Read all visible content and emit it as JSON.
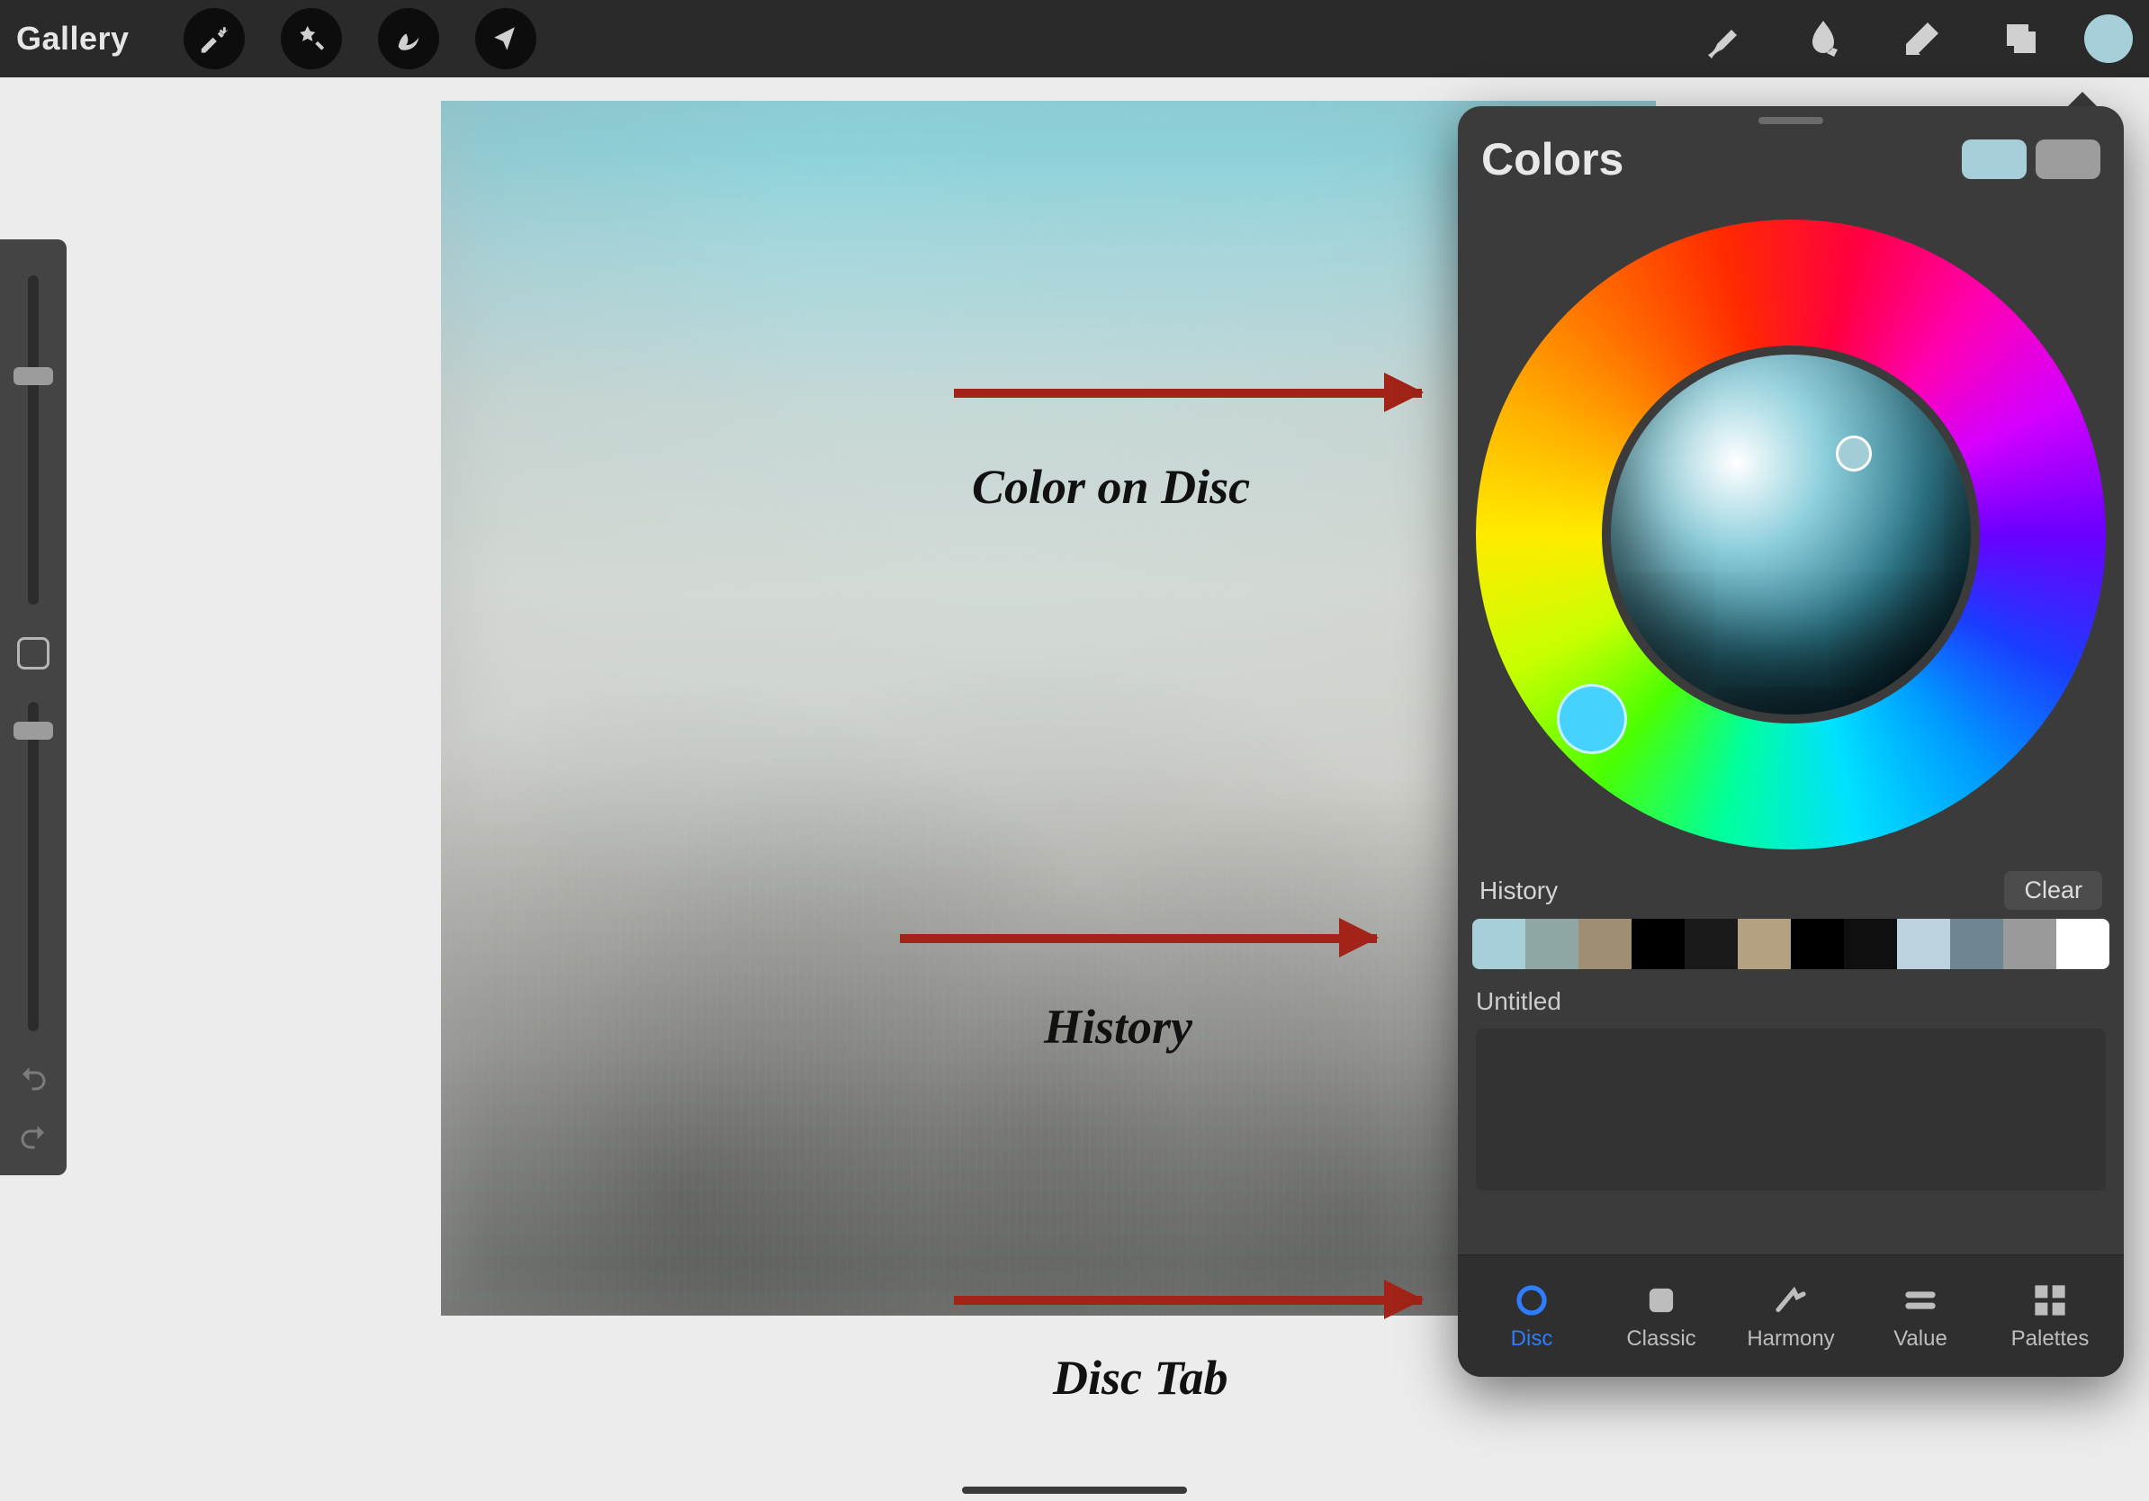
{
  "toolbar": {
    "gallery_label": "Gallery"
  },
  "annotations": {
    "color_on_disc": "Color on Disc",
    "history": "History",
    "disc_tab": "Disc Tab"
  },
  "color_panel": {
    "title": "Colors",
    "primary_swatch": "#a6cfd9",
    "secondary_swatch": "#9d9d9d",
    "history_label": "History",
    "clear_label": "Clear",
    "history_colors": [
      "#a6cfd9",
      "#8fa7a4",
      "#a08e72",
      "#000000",
      "#1a1a1a",
      "#b3a181",
      "#000000",
      "#0f0f0f",
      "#bcd2df",
      "#6e8592",
      "#9a9a9a",
      "#ffffff"
    ],
    "palette_name": "Untitled",
    "tabs": {
      "disc": "Disc",
      "classic": "Classic",
      "harmony": "Harmony",
      "value": "Value",
      "palettes": "Palettes",
      "active": "disc"
    }
  }
}
